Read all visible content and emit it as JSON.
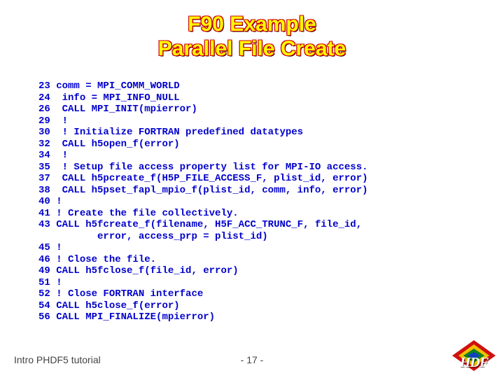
{
  "title_line1": "F90 Example",
  "title_line2": "Parallel File Create",
  "code": [
    {
      "n": "23",
      "t": "comm = MPI_COMM_WORLD"
    },
    {
      "n": "24",
      "t": " info = MPI_INFO_NULL"
    },
    {
      "n": "26",
      "t": " CALL MPI_INIT(mpierror)"
    },
    {
      "n": "29",
      "t": " !"
    },
    {
      "n": "30",
      "t": " ! Initialize FORTRAN predefined datatypes"
    },
    {
      "n": "32",
      "t": " CALL h5open_f(error)"
    },
    {
      "n": "34",
      "t": " !"
    },
    {
      "n": "35",
      "t": " ! Setup file access property list for MPI-IO access."
    },
    {
      "n": "37",
      "t": " CALL h5pcreate_f(H5P_FILE_ACCESS_F, plist_id, error)"
    },
    {
      "n": "38",
      "t": " CALL h5pset_fapl_mpio_f(plist_id, comm, info, error)"
    },
    {
      "n": "40",
      "t": "!"
    },
    {
      "n": "41",
      "t": "! Create the file collectively."
    },
    {
      "n": "43",
      "t": "CALL h5fcreate_f(filename, H5F_ACC_TRUNC_F, file_id,"
    },
    {
      "n": "",
      "t": "       error, access_prp = plist_id)"
    },
    {
      "n": "45",
      "t": "!"
    },
    {
      "n": "46",
      "t": "! Close the file."
    },
    {
      "n": "49",
      "t": "CALL h5fclose_f(file_id, error)"
    },
    {
      "n": "51",
      "t": "!"
    },
    {
      "n": "52",
      "t": "! Close FORTRAN interface"
    },
    {
      "n": "54",
      "t": "CALL h5close_f(error)"
    },
    {
      "n": "56",
      "t": "CALL MPI_FINALIZE(mpierror)"
    }
  ],
  "footer_left": "Intro PHDF5 tutorial",
  "footer_center": "- 17 -",
  "logo_text": "HDF",
  "colors": {
    "title_fill": "#ffff00",
    "title_outline": "#d00000",
    "code": "#0000cc",
    "footer": "#444444"
  }
}
